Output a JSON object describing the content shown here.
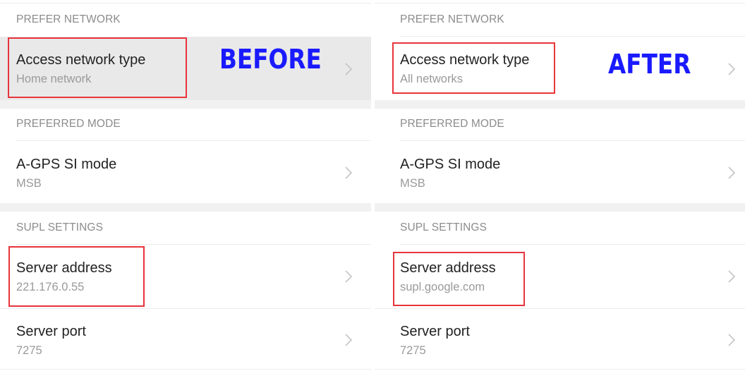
{
  "colors": {
    "annotation_text": "#1a1aff",
    "highlight_box": "#e8343b",
    "section_header": "#8c8c8c",
    "item_title": "#222222",
    "item_value": "#9a9a9a",
    "selected_row_bg": "#e9e9e9"
  },
  "panels": [
    {
      "annotation": "BEFORE",
      "sections": [
        {
          "header": "PREFER NETWORK",
          "items": [
            {
              "title": "Access network type",
              "value": "Home network",
              "icon": "chevron-right-icon"
            }
          ]
        },
        {
          "header": "PREFERRED MODE",
          "items": [
            {
              "title": "A-GPS SI mode",
              "value": "MSB",
              "icon": "chevron-right-icon"
            }
          ]
        },
        {
          "header": "SUPL SETTINGS",
          "items": [
            {
              "title": "Server address",
              "value": "221.176.0.55",
              "icon": "chevron-right-icon"
            },
            {
              "title": "Server port",
              "value": "7275",
              "icon": "chevron-right-icon"
            }
          ]
        }
      ]
    },
    {
      "annotation": "AFTER",
      "sections": [
        {
          "header": "PREFER NETWORK",
          "items": [
            {
              "title": "Access network type",
              "value": "All networks",
              "icon": "chevron-right-icon"
            }
          ]
        },
        {
          "header": "PREFERRED MODE",
          "items": [
            {
              "title": "A-GPS SI mode",
              "value": "MSB",
              "icon": "chevron-right-icon"
            }
          ]
        },
        {
          "header": "SUPL SETTINGS",
          "items": [
            {
              "title": "Server address",
              "value": "supl.google.com",
              "icon": "chevron-right-icon"
            },
            {
              "title": "Server port",
              "value": "7275",
              "icon": "chevron-right-icon"
            }
          ]
        }
      ]
    }
  ]
}
